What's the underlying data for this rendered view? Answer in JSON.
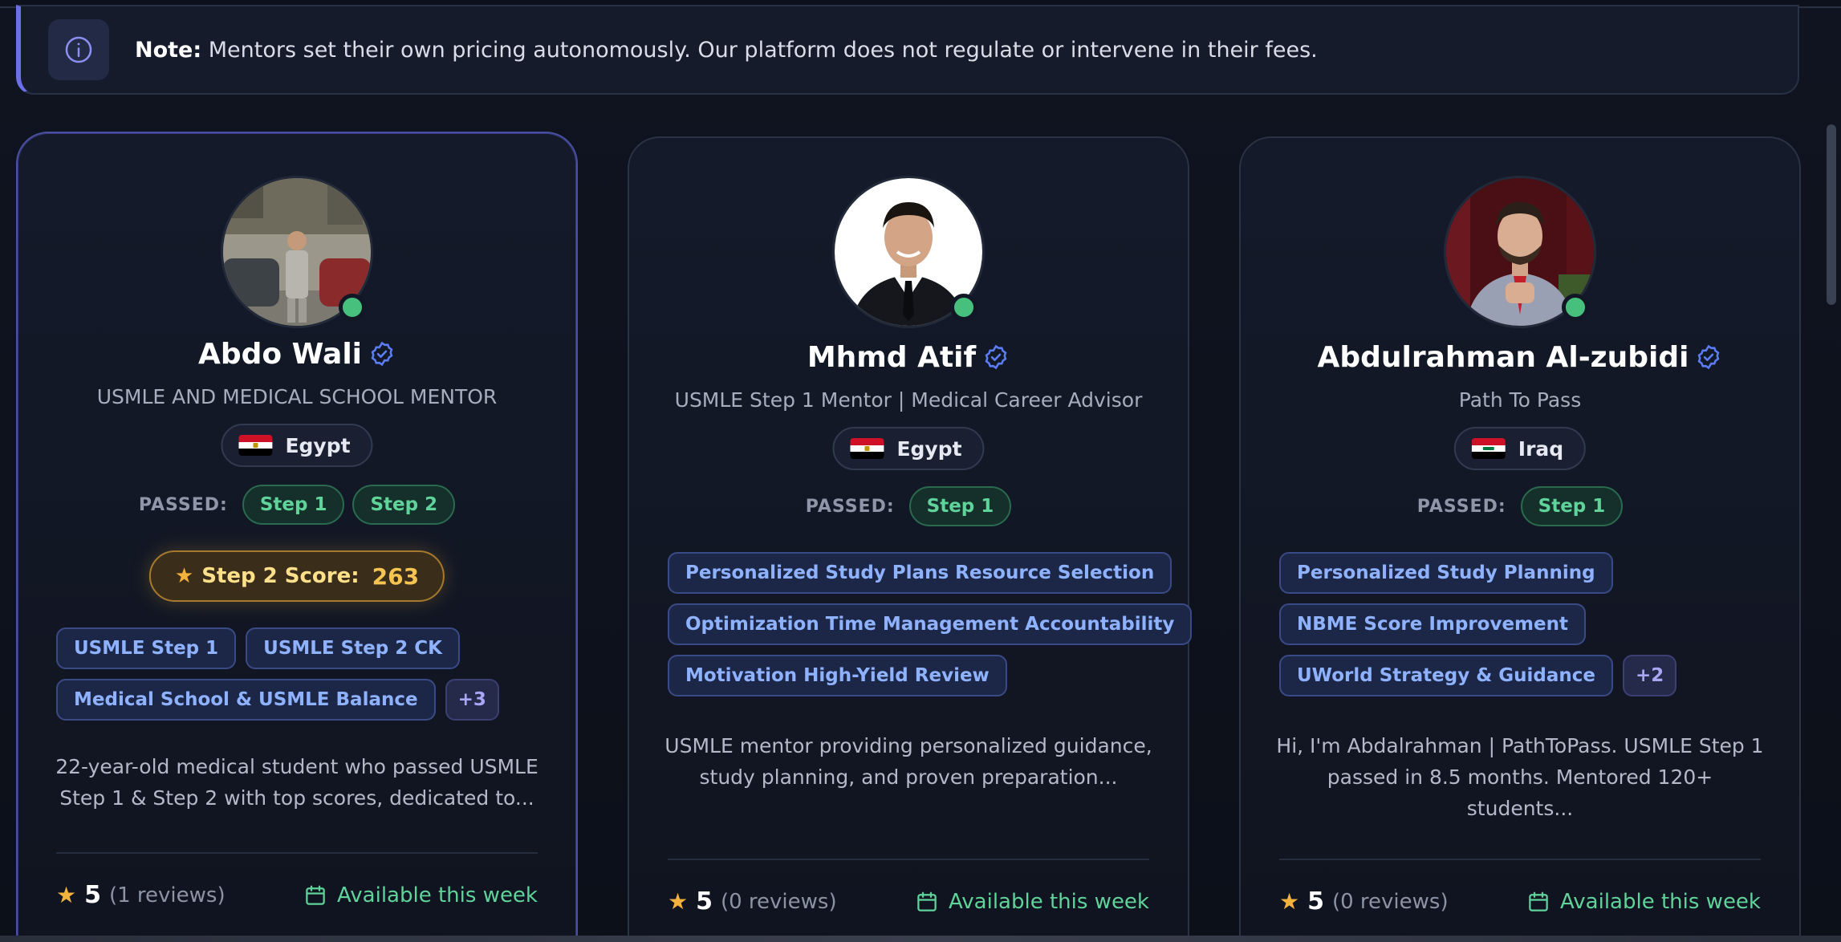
{
  "note": {
    "prefix": "Note:",
    "text": " Mentors set their own pricing autonomously. Our platform does not regulate or intervene in their fees."
  },
  "passed_label": "PASSED:",
  "mentors": [
    {
      "name": "Abdo Wali",
      "subtitle": "USMLE AND MEDICAL SCHOOL MENTOR",
      "country": "Egypt",
      "passed": [
        "Step 1",
        "Step 2"
      ],
      "score_label": "Step 2 Score:",
      "score_value": "263",
      "tags": [
        "USMLE Step 1",
        "USMLE Step 2 CK",
        "Medical School & USMLE Balance"
      ],
      "more_tags": "+3",
      "bio_line1": "22-year-old medical student who passed USMLE",
      "bio_line2": "Step 1 & Step 2 with top scores, dedicated to...",
      "rating": "5",
      "reviews": "(1 reviews)",
      "availability": "Available this week"
    },
    {
      "name": "Mhmd Atif",
      "subtitle": "USMLE Step 1 Mentor | Medical Career Advisor",
      "country": "Egypt",
      "passed": [
        "Step 1"
      ],
      "tags": [
        "Personalized Study Plans Resource Selection",
        "Optimization Time Management Accountability",
        "Motivation High-Yield Review"
      ],
      "bio_line1": "USMLE mentor providing personalized guidance,",
      "bio_line2": "study planning, and proven preparation...",
      "rating": "5",
      "reviews": "(0 reviews)",
      "availability": "Available this week"
    },
    {
      "name": "Abdulrahman Al-zubidi",
      "subtitle": "Path To Pass",
      "country": "Iraq",
      "passed": [
        "Step 1"
      ],
      "tags": [
        "Personalized Study Planning",
        "NBME Score Improvement",
        "UWorld Strategy & Guidance"
      ],
      "more_tags": "+2",
      "bio_line1": "Hi, I'm Abdalrahman | PathToPass. USMLE Step 1",
      "bio_line2": "passed in 8.5 months. Mentored 120+ students...",
      "rating": "5",
      "reviews": "(0 reviews)",
      "availability": "Available this week"
    }
  ],
  "colors": {
    "accent": "#6b6fe8",
    "success": "#5fd39a",
    "tag_text": "#8fb2ff",
    "gold": "#f6c451"
  }
}
